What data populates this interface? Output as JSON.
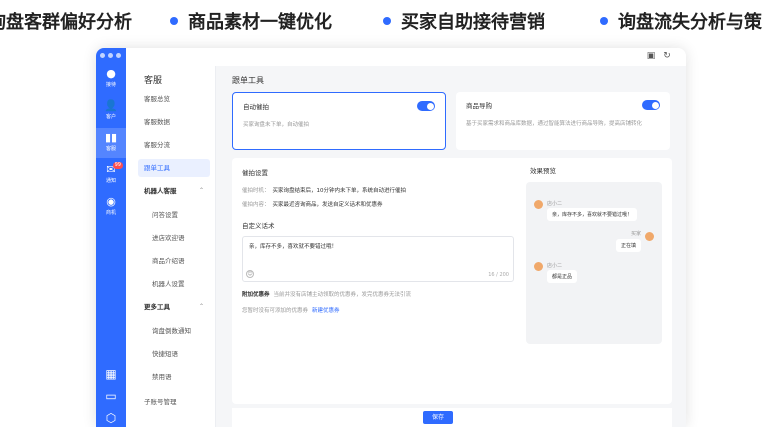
{
  "banner": {
    "items": [
      "询盘客群偏好分析",
      "商品素材一键优化",
      "买家自助接待营销",
      "询盘流失分析与策"
    ]
  },
  "rail": {
    "items": [
      {
        "label": "接待",
        "icon": "chat-icon"
      },
      {
        "label": "客户",
        "icon": "user-icon"
      },
      {
        "label": "客服",
        "icon": "bar-chart-icon"
      },
      {
        "label": "通知",
        "icon": "mail-icon",
        "badge": "99"
      },
      {
        "label": "商机",
        "icon": "opportunity-icon"
      }
    ]
  },
  "subnav": {
    "title": "客服",
    "items": [
      "客服总览",
      "客服数据",
      "客服分流",
      "跟单工具"
    ],
    "group1": "机器人客服",
    "group1_items": [
      "问答设置",
      "进店欢迎语",
      "商品介绍语",
      "机器人设置"
    ],
    "group2": "更多工具",
    "group2_items": [
      "询盘倒数通知",
      "快捷短语",
      "禁用语"
    ],
    "footer": "子账号管理"
  },
  "main": {
    "header": "跟单工具",
    "features": [
      {
        "title": "自动催拍",
        "desc": "买家询盘未下单，自动催拍"
      },
      {
        "title": "商品导购",
        "desc": "基于买家需求和商品库数据，通过智能算法进行商品导购，提高店铺转化"
      }
    ],
    "settings": {
      "title": "催拍设置",
      "timing_label": "催拍时机：",
      "timing_value": "买家询盘结束后，10分钟内未下单，系统自动进行催拍",
      "content_label": "催拍内容：",
      "content_value": "买家最近咨询商品，发送自定义话术和优惠券",
      "custom_title": "自定义话术",
      "custom_text": "亲，库存不多，喜欢就不要错过哦！",
      "counter": "16 / 200",
      "coupon_label": "附加优惠券",
      "coupon_hint": "当前并没有店铺主动领取的优惠券，发完优惠券无法引流",
      "coupon_tip": "您暂时没有可添加的优惠券",
      "coupon_link": "新建优惠券"
    },
    "preview": {
      "title": "效果预览",
      "messages": [
        {
          "name": "店小二",
          "text": "亲，库存不多，喜欢就不要错过哦！",
          "side": "left"
        },
        {
          "name": "买家",
          "text": "正在填",
          "side": "right"
        },
        {
          "name": "店小二",
          "text": "都是正品",
          "side": "left"
        }
      ]
    },
    "save_label": "保存"
  },
  "colors": {
    "accent": "#2f6bff",
    "rail": "#2f6bff",
    "badge": "#ff4d4f"
  }
}
